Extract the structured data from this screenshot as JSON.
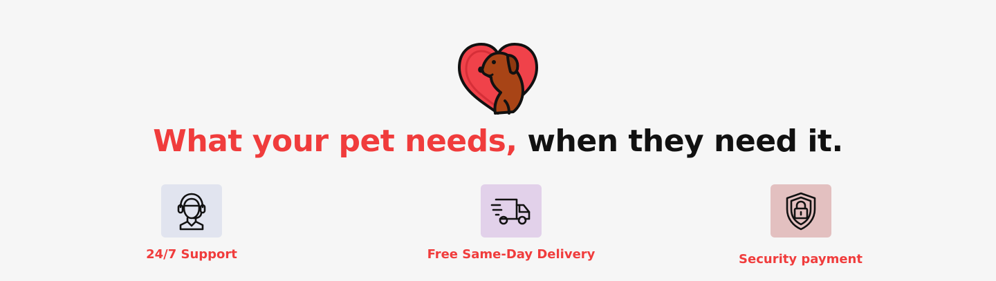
{
  "brand": {
    "logo_icon": "dog-in-heart-icon",
    "accent_color": "#f03c3c"
  },
  "headline": {
    "highlight": "What your pet needs,",
    "rest": "when they need it."
  },
  "features": [
    {
      "label": "24/7 Support",
      "icon": "support-agent-icon",
      "tile_color": "#e1e4ef"
    },
    {
      "label": "Free Same-Day Delivery",
      "icon": "delivery-truck-icon",
      "tile_color": "#e2d1ea"
    },
    {
      "label": "Security payment",
      "icon": "shield-lock-icon",
      "tile_color": "#e3c0c0"
    }
  ]
}
